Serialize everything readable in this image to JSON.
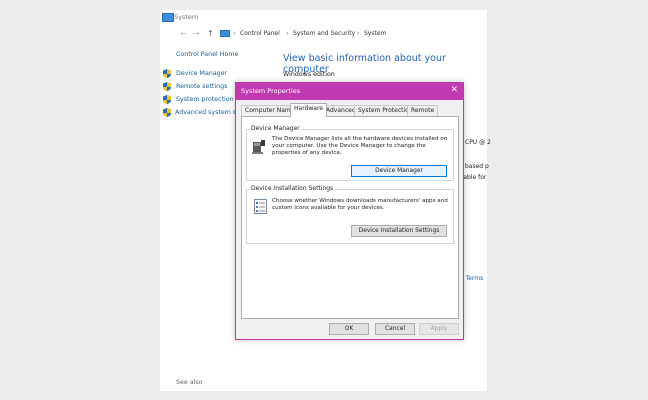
{
  "window": {
    "title": "System",
    "breadcrumb": [
      "Control Panel",
      "System and Security",
      "System"
    ],
    "sidebar": {
      "home": "Control Panel Home",
      "items": [
        {
          "label": "Device Manager"
        },
        {
          "label": "Remote settings"
        },
        {
          "label": "System protection"
        },
        {
          "label": "Advanced system settings"
        }
      ]
    },
    "main": {
      "title": "View basic information about your computer",
      "windows_edition": "Windows edition",
      "peek": {
        "cpu": "CPU @ 2",
        "based": "based p",
        "available": "ilable for",
        "terms": "e Terms"
      }
    },
    "see_also": "See also"
  },
  "dialog": {
    "title": "System Properties",
    "close": "✕",
    "tabs": [
      {
        "label": "Computer Name",
        "active": false
      },
      {
        "label": "Hardware",
        "active": true
      },
      {
        "label": "Advanced",
        "active": false
      },
      {
        "label": "System Protection",
        "active": false
      },
      {
        "label": "Remote",
        "active": false
      }
    ],
    "device_manager": {
      "heading": "Device Manager",
      "text": "The Device Manager lists all the hardware devices installed on your computer. Use the Device Manager to change the properties of any device.",
      "button": "Device Manager"
    },
    "device_install": {
      "heading": "Device Installation Settings",
      "text": "Choose whether Windows downloads manufacturers' apps and custom icons available for your devices.",
      "button": "Device Installation Settings"
    },
    "buttons": {
      "ok": "OK",
      "cancel": "Cancel",
      "apply": "Apply"
    }
  },
  "colors": {
    "dialog_accent": "#c23ab1",
    "link": "#1a5e9a",
    "heading_blue": "#2563b8"
  },
  "icons": [
    "system-icon",
    "back-arrow-icon",
    "forward-arrow-icon",
    "up-arrow-icon",
    "shield-icon",
    "close-icon",
    "device-manager-icon",
    "device-installation-icon"
  ]
}
